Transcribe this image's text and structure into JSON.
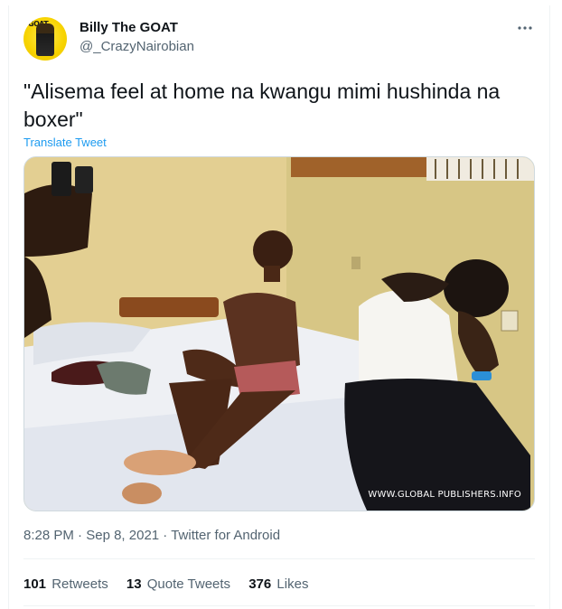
{
  "user": {
    "name": "Billy The GOAT",
    "handle": "@_CrazyNairobian",
    "avatar_text": "GOAT"
  },
  "tweet": {
    "text": "\"Alisema feel at home na kwangu mimi hushinda na boxer\"",
    "translate_label": "Translate Tweet",
    "more_icon": "more-horizontal-icon"
  },
  "media": {
    "watermark": "WWW.GLOBAL PUBLISHERS.INFO"
  },
  "meta": {
    "time": "8:28 PM",
    "separator1": " · ",
    "date": "Sep 8, 2021",
    "separator2": " · ",
    "source": "Twitter for Android"
  },
  "stats": {
    "retweets_count": "101",
    "retweets_label": "Retweets",
    "quotes_count": "13",
    "quotes_label": "Quote Tweets",
    "likes_count": "376",
    "likes_label": "Likes"
  },
  "colors": {
    "accent": "#1d9bf0",
    "secondary_text": "#536471",
    "primary_text": "#0f1419"
  }
}
